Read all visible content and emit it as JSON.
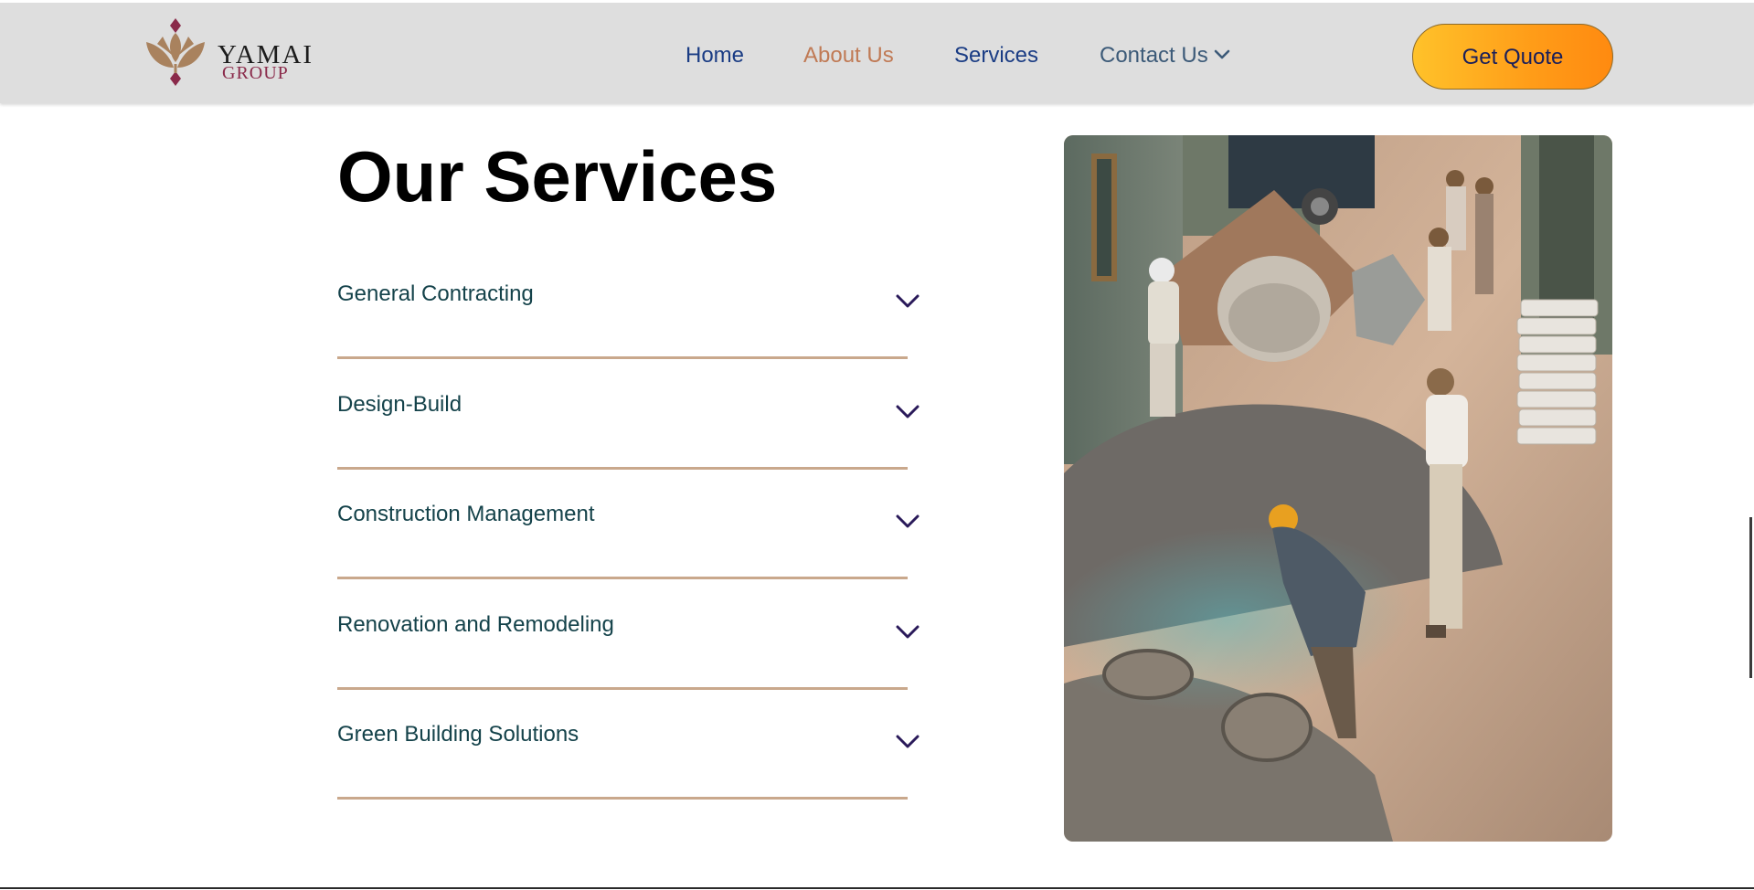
{
  "brand": {
    "name": "YAMAI",
    "sub": "GROUP",
    "logo_icon": "lotus-icon",
    "colors": {
      "brown": "#a9825e",
      "maroon": "#8a2a4a"
    }
  },
  "nav": {
    "home": "Home",
    "about": "About Us",
    "services": "Services",
    "contact": "Contact Us",
    "contact_icon": "chevron-down-icon"
  },
  "cta": {
    "label": "Get Quote"
  },
  "main": {
    "title": "Our Services",
    "services": [
      {
        "label": "General Contracting",
        "icon": "chevron-down-icon"
      },
      {
        "label": "Design-Build",
        "icon": "chevron-down-icon"
      },
      {
        "label": "Construction Management",
        "icon": "chevron-down-icon"
      },
      {
        "label": "Renovation and Remodeling",
        "icon": "chevron-down-icon"
      },
      {
        "label": "Green Building Solutions",
        "icon": "chevron-down-icon"
      }
    ],
    "photo_icon": "construction-workers-photo"
  },
  "colors": {
    "header_bg": "#dedede",
    "nav_blue": "#1a3c84",
    "nav_active": "#c07a55",
    "divider": "#c9a88c",
    "service_text": "#14424a",
    "chevron": "#2a1a5a",
    "button_gradient": [
      "#ffc22a",
      "#ff8a10"
    ]
  }
}
